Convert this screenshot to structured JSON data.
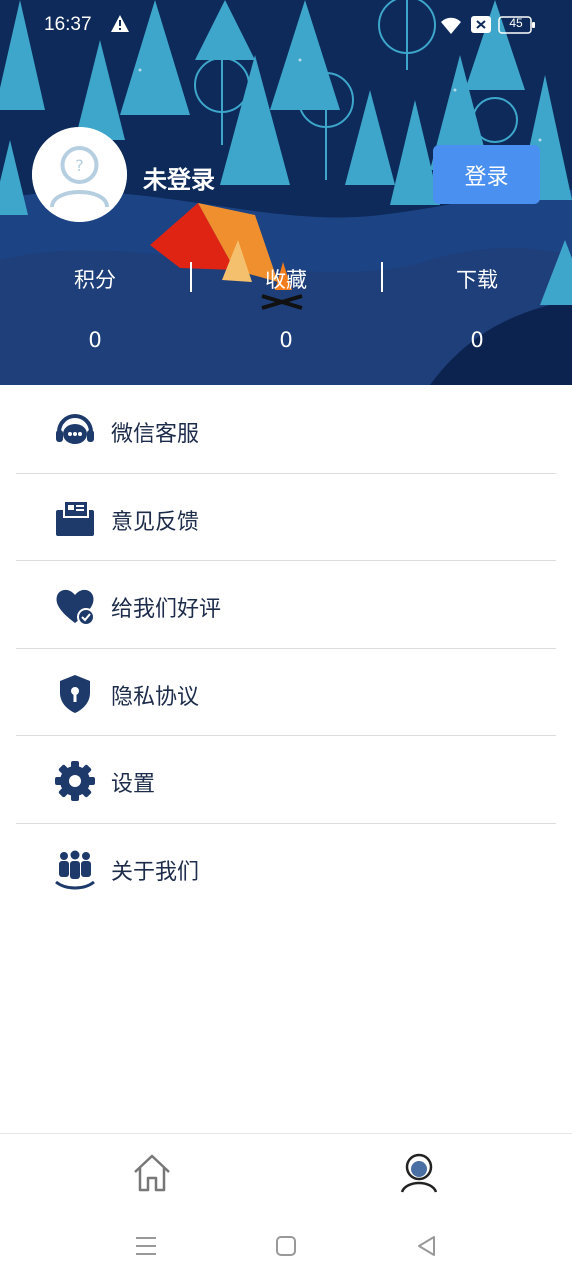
{
  "status_bar": {
    "time": "16:37",
    "battery": "45",
    "icons": [
      "warning-icon",
      "wifi-icon",
      "sim-off-icon",
      "battery-icon"
    ]
  },
  "profile": {
    "username": "未登录",
    "login_button": "登录",
    "avatar_icon": "default-avatar-icon"
  },
  "stats": [
    {
      "label": "积分",
      "value": "0"
    },
    {
      "label": "收藏",
      "value": "0"
    },
    {
      "label": "下载",
      "value": "0"
    }
  ],
  "menu": [
    {
      "label": "微信客服",
      "icon": "headset-chat-icon"
    },
    {
      "label": "意见反馈",
      "icon": "feedback-box-icon"
    },
    {
      "label": "给我们好评",
      "icon": "heart-check-icon"
    },
    {
      "label": "隐私协议",
      "icon": "shield-lock-icon"
    },
    {
      "label": "设置",
      "icon": "gear-icon"
    },
    {
      "label": "关于我们",
      "icon": "team-icon"
    }
  ],
  "tabs": [
    {
      "name": "home",
      "icon": "home-icon",
      "active": false
    },
    {
      "name": "profile",
      "icon": "user-icon",
      "active": true
    }
  ],
  "nav_buttons": [
    "menu-icon",
    "square-icon",
    "back-triangle-icon"
  ],
  "colors": {
    "hero_dark": "#0e2c5e",
    "hero_mid": "#1a3f7d",
    "tree": "#3aa3c9",
    "accent_blue": "#4a90f0",
    "menu_icon": "#1d3a6b",
    "menu_text": "#1d2c4a",
    "tent_red": "#e02414",
    "tent_orange": "#f5b35d"
  }
}
